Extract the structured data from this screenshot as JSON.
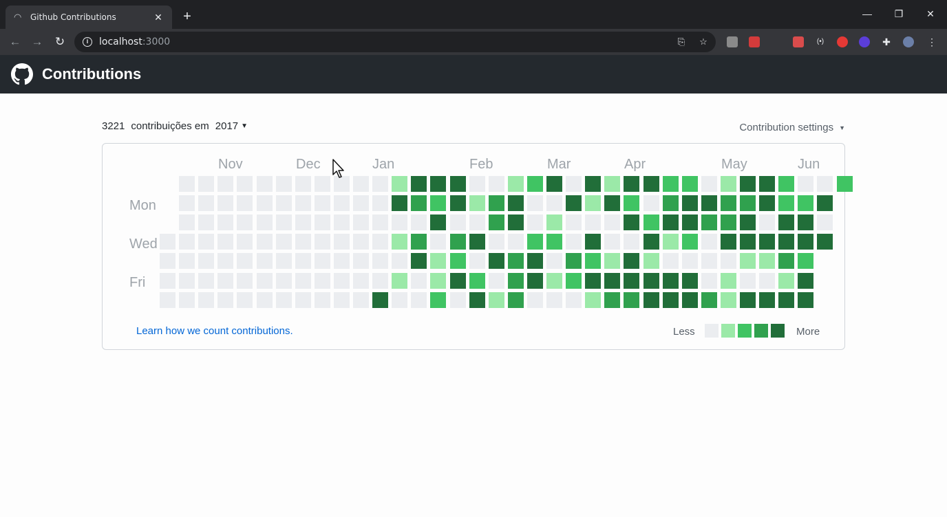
{
  "browser": {
    "tab_title": "Github Contributions",
    "tab_icon": "loading-spinner-icon",
    "url_host": "localhost",
    "url_port": ":3000"
  },
  "header": {
    "title": "Contributions",
    "logo": "github-icon"
  },
  "summary": {
    "count": "3221",
    "text": "contribuições em",
    "year": "2017"
  },
  "settings_label": "Contribution settings",
  "months": [
    "Nov",
    "Dec",
    "Jan",
    "Feb",
    "Mar",
    "Apr",
    "May",
    "Jun"
  ],
  "weekdays": [
    "Mon",
    "Wed",
    "Fri"
  ],
  "learn_link": "Learn how we count contributions.",
  "legend": {
    "less": "Less",
    "more": "More",
    "colors": [
      "#ebedf0",
      "#9be9a8",
      "#40c463",
      "#30a14e",
      "#216e39"
    ]
  },
  "contribution_grid": [
    [
      null,
      0,
      0,
      0,
      0,
      0,
      0,
      0,
      0,
      0,
      0,
      0,
      1,
      4,
      4,
      4,
      0,
      0,
      1,
      2,
      4,
      0,
      4,
      1,
      4,
      4,
      2,
      2,
      0,
      1,
      4,
      4,
      2,
      0,
      0,
      2
    ],
    [
      null,
      0,
      0,
      0,
      0,
      0,
      0,
      0,
      0,
      0,
      0,
      0,
      4,
      3,
      2,
      4,
      1,
      3,
      4,
      0,
      0,
      4,
      1,
      4,
      2,
      0,
      3,
      4,
      4,
      3,
      3,
      4,
      2,
      2,
      4
    ],
    [
      null,
      0,
      0,
      0,
      0,
      0,
      0,
      0,
      0,
      0,
      0,
      0,
      0,
      0,
      4,
      0,
      0,
      3,
      4,
      0,
      1,
      0,
      0,
      0,
      4,
      2,
      4,
      4,
      3,
      3,
      4,
      0,
      4,
      4,
      0
    ],
    [
      0,
      0,
      0,
      0,
      0,
      0,
      0,
      0,
      0,
      0,
      0,
      0,
      1,
      3,
      0,
      3,
      4,
      0,
      0,
      2,
      2,
      0,
      4,
      0,
      0,
      4,
      1,
      2,
      0,
      4,
      4,
      4,
      4,
      4,
      4
    ],
    [
      0,
      0,
      0,
      0,
      0,
      0,
      0,
      0,
      0,
      0,
      0,
      0,
      0,
      4,
      1,
      2,
      0,
      4,
      3,
      4,
      0,
      3,
      2,
      1,
      4,
      1,
      0,
      0,
      0,
      0,
      1,
      1,
      3,
      2
    ],
    [
      0,
      0,
      0,
      0,
      0,
      0,
      0,
      0,
      0,
      0,
      0,
      0,
      1,
      0,
      1,
      4,
      2,
      0,
      3,
      4,
      1,
      2,
      4,
      4,
      4,
      4,
      4,
      4,
      0,
      1,
      0,
      0,
      1,
      4
    ],
    [
      0,
      0,
      0,
      0,
      0,
      0,
      0,
      0,
      0,
      0,
      0,
      4,
      0,
      0,
      2,
      0,
      4,
      1,
      3,
      0,
      0,
      0,
      1,
      3,
      3,
      4,
      4,
      4,
      3,
      1,
      4,
      4,
      4,
      4
    ]
  ]
}
